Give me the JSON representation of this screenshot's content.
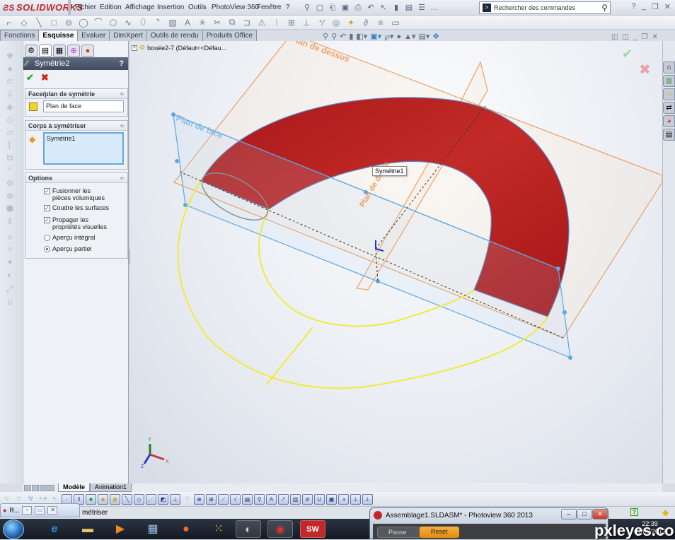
{
  "app": {
    "brand": "SOLIDWORKS",
    "menu": [
      "Fichier",
      "Edition",
      "Affichage",
      "Insertion",
      "Outils",
      "PhotoView 360",
      "Fenêtre",
      "?"
    ],
    "search_placeholder": "Rechercher des commandes"
  },
  "command_tabs": [
    {
      "label": "Fonctions",
      "active": false
    },
    {
      "label": "Esquisse",
      "active": true
    },
    {
      "label": "Evaluer",
      "active": false
    },
    {
      "label": "DimXpert",
      "active": false
    },
    {
      "label": "Outils de rendu",
      "active": false
    },
    {
      "label": "Produits Office",
      "active": false
    }
  ],
  "property_manager": {
    "title": "Symétrie2",
    "help": "?",
    "ok_icon": "✔",
    "cancel_icon": "✖",
    "groups": {
      "plane": {
        "title": "Face/plan de symétrie",
        "value": "Plan de face"
      },
      "bodies": {
        "title": "Corps à symétriser",
        "value": "Symétrie1"
      },
      "options": {
        "title": "Options",
        "checkboxes": [
          {
            "label": "Fusionner les pièces volumiques",
            "checked": true
          },
          {
            "label": "Coudre les surfaces",
            "checked": true
          },
          {
            "label": "Propager les propriétés visuelles",
            "checked": true
          }
        ],
        "radios": [
          {
            "label": "Aperçu intégral",
            "selected": false
          },
          {
            "label": "Aperçu partiel",
            "selected": true
          }
        ]
      }
    }
  },
  "feature_tree": {
    "root": "bouée2-7  (Défaut<<Défau..."
  },
  "viewport": {
    "plane_labels": [
      "Plan de dessus",
      "Plan de face",
      "Plan de droite"
    ],
    "tooltip": "Symétrie1",
    "triad": {
      "x": "X",
      "y": "Y",
      "z": "Z"
    },
    "colors": {
      "body": "#b01c1c",
      "plane_orange": "#e9924a",
      "plane_blue": "#5aa8e8",
      "sketch": "#f2ea3a"
    }
  },
  "model_tabs": [
    {
      "label": "Modèle",
      "active": true
    },
    {
      "label": "Animation1",
      "active": false
    }
  ],
  "status": {
    "text": "métriser",
    "minimized_window": "R..."
  },
  "photoview": {
    "title": "Assemblage1.SLDASM* - Photoview 360 2013",
    "pause": "Pause",
    "reset": "Reset"
  },
  "taskbar": {
    "time": "22:39",
    "date": "01/09/2013"
  },
  "watermark": "pxleyes.com"
}
